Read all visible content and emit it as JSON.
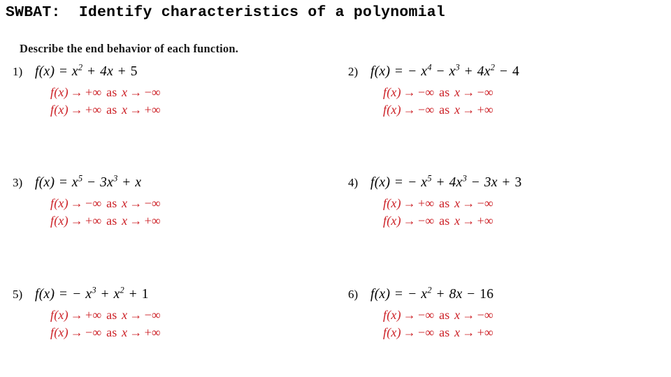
{
  "header": {
    "text": "SWBAT:  Identify characteristics of a polynomial"
  },
  "worksheet": {
    "directions": "Describe the end behavior of each function.",
    "answer_color": "#cc2026",
    "text_color": "#000000",
    "background_color": "#ffffff",
    "problems": [
      {
        "number": "1)",
        "fx": "f",
        "arg": "(x)",
        "equals": "=",
        "terms": [
          {
            "coef": "x",
            "sup": "2"
          },
          {
            "op": "+",
            "coef": "4x"
          },
          {
            "op": "+",
            "coef": "5"
          }
        ],
        "plain_equation": "f(x) = x² + 4x + 5",
        "answers": [
          {
            "lhs": "f(x)",
            "arrow": "→",
            "limit": "+∞",
            "as": "as",
            "var": "x",
            "arrow2": "→",
            "approach": "−∞"
          },
          {
            "lhs": "f(x)",
            "arrow": "→",
            "limit": "+∞",
            "as": "as",
            "var": "x",
            "arrow2": "→",
            "approach": "+∞"
          }
        ]
      },
      {
        "number": "2)",
        "fx": "f",
        "arg": "(x)",
        "equals": "=",
        "terms": [
          {
            "op": "−",
            "coef": "x",
            "sup": "4"
          },
          {
            "op": "−",
            "coef": "x",
            "sup": "3"
          },
          {
            "op": "+",
            "coef": "4x",
            "sup": "2"
          },
          {
            "op": "−",
            "coef": "4"
          }
        ],
        "plain_equation": "f(x) = −x⁴ − x³ + 4x² − 4",
        "answers": [
          {
            "lhs": "f(x)",
            "arrow": "→",
            "limit": "−∞",
            "as": "as",
            "var": "x",
            "arrow2": "→",
            "approach": "−∞"
          },
          {
            "lhs": "f(x)",
            "arrow": "→",
            "limit": "−∞",
            "as": "as",
            "var": "x",
            "arrow2": "→",
            "approach": "+∞"
          }
        ]
      },
      {
        "number": "3)",
        "fx": "f",
        "arg": "(x)",
        "equals": "=",
        "terms": [
          {
            "coef": "x",
            "sup": "5"
          },
          {
            "op": "−",
            "coef": "3x",
            "sup": "3"
          },
          {
            "op": "+",
            "coef": "x"
          }
        ],
        "plain_equation": "f(x) = x⁵ − 3x³ + x",
        "answers": [
          {
            "lhs": "f(x)",
            "arrow": "→",
            "limit": "−∞",
            "as": "as",
            "var": "x",
            "arrow2": "→",
            "approach": "−∞"
          },
          {
            "lhs": "f(x)",
            "arrow": "→",
            "limit": "+∞",
            "as": "as",
            "var": "x",
            "arrow2": "→",
            "approach": "+∞"
          }
        ]
      },
      {
        "number": "4)",
        "fx": "f",
        "arg": "(x)",
        "equals": "=",
        "terms": [
          {
            "op": "−",
            "coef": "x",
            "sup": "5"
          },
          {
            "op": "+",
            "coef": "4x",
            "sup": "3"
          },
          {
            "op": "−",
            "coef": "3x"
          },
          {
            "op": "+",
            "coef": "3"
          }
        ],
        "plain_equation": "f(x) = −x⁵ + 4x³ − 3x + 3",
        "answers": [
          {
            "lhs": "f(x)",
            "arrow": "→",
            "limit": "+∞",
            "as": "as",
            "var": "x",
            "arrow2": "→",
            "approach": "−∞"
          },
          {
            "lhs": "f(x)",
            "arrow": "→",
            "limit": "−∞",
            "as": "as",
            "var": "x",
            "arrow2": "→",
            "approach": "+∞"
          }
        ]
      },
      {
        "number": "5)",
        "fx": "f",
        "arg": "(x)",
        "equals": "=",
        "terms": [
          {
            "op": "−",
            "coef": "x",
            "sup": "3"
          },
          {
            "op": "+",
            "coef": "x",
            "sup": "2"
          },
          {
            "op": "+",
            "coef": "1"
          }
        ],
        "plain_equation": "f(x) = −x³ + x² + 1",
        "answers": [
          {
            "lhs": "f(x)",
            "arrow": "→",
            "limit": "+∞",
            "as": "as",
            "var": "x",
            "arrow2": "→",
            "approach": "−∞"
          },
          {
            "lhs": "f(x)",
            "arrow": "→",
            "limit": "−∞",
            "as": "as",
            "var": "x",
            "arrow2": "→",
            "approach": "+∞"
          }
        ]
      },
      {
        "number": "6)",
        "fx": "f",
        "arg": "(x)",
        "equals": "=",
        "terms": [
          {
            "op": "−",
            "coef": "x",
            "sup": "2"
          },
          {
            "op": "+",
            "coef": "8x"
          },
          {
            "op": "−",
            "coef": "16"
          }
        ],
        "plain_equation": "f(x) = −x² + 8x − 16",
        "answers": [
          {
            "lhs": "f(x)",
            "arrow": "→",
            "limit": "−∞",
            "as": "as",
            "var": "x",
            "arrow2": "→",
            "approach": "−∞"
          },
          {
            "lhs": "f(x)",
            "arrow": "→",
            "limit": "−∞",
            "as": "as",
            "var": "x",
            "arrow2": "→",
            "approach": "+∞"
          }
        ]
      }
    ]
  }
}
